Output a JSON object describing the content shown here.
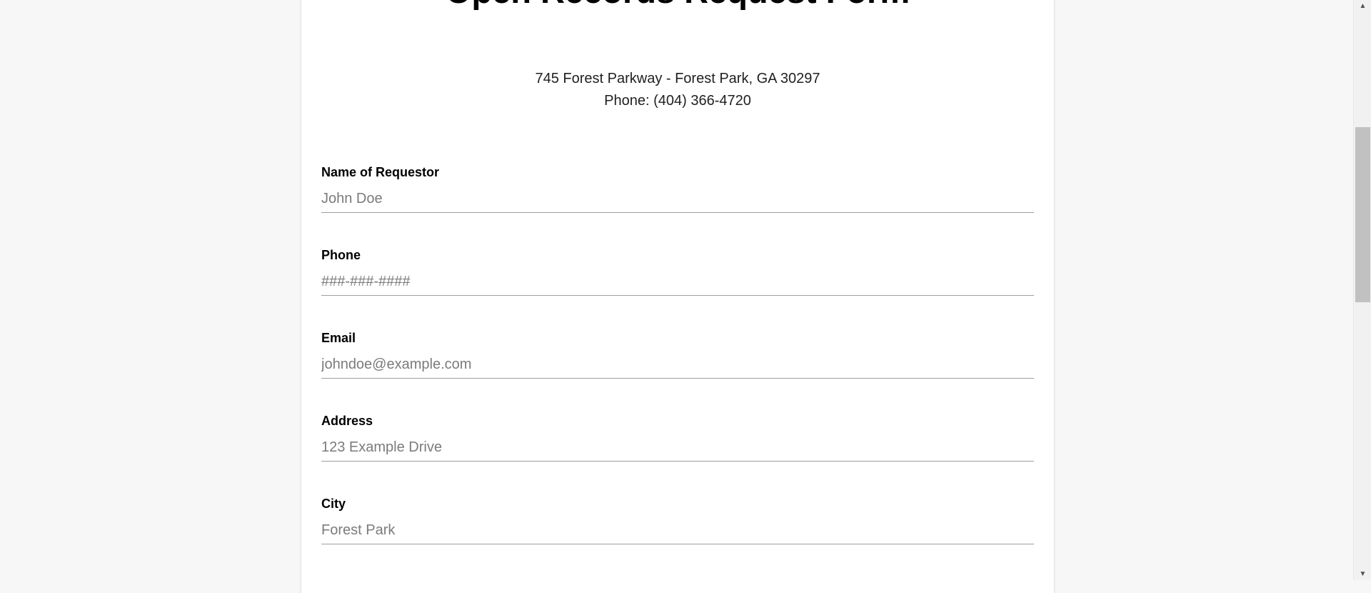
{
  "form": {
    "title": "Open Records Request Form",
    "address_line": "745 Forest Parkway - Forest Park, GA 30297",
    "phone_line": "Phone: (404) 366-4720",
    "fields": [
      {
        "label": "Name of Requestor",
        "placeholder": "John Doe",
        "value": ""
      },
      {
        "label": "Phone",
        "placeholder": "###-###-####",
        "value": ""
      },
      {
        "label": "Email",
        "placeholder": "johndoe@example.com",
        "value": ""
      },
      {
        "label": "Address",
        "placeholder": "123 Example Drive",
        "value": ""
      },
      {
        "label": "City",
        "placeholder": "Forest Park",
        "value": ""
      }
    ]
  },
  "scrollbar": {
    "up_icon": "triangle-up",
    "down_icon": "triangle-down",
    "scroll_position_fraction": 0.22
  },
  "colors": {
    "page_background": "#f7f7f7",
    "card_background": "#ffffff",
    "input_underline": "#9e9e9e",
    "placeholder_text": "#7b7b7b"
  }
}
